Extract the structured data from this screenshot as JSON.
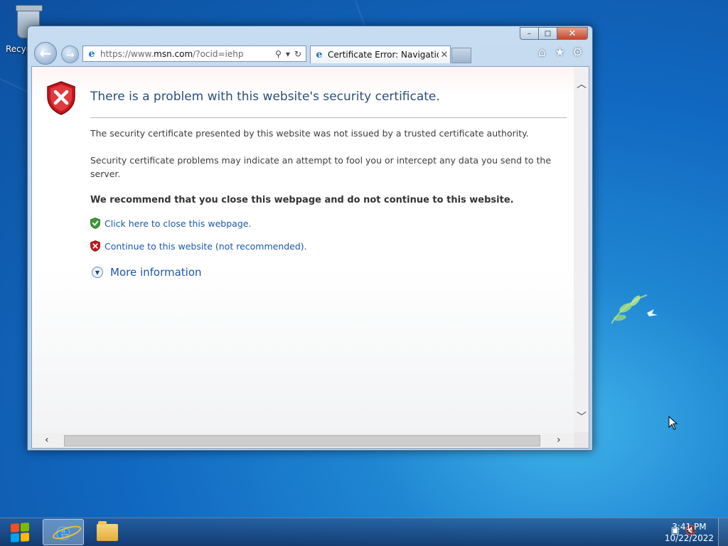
{
  "desktop": {
    "recycle_bin_label": "Recyc"
  },
  "browser": {
    "address": {
      "url_prefix": "https://www.",
      "url_host": "msn.com",
      "url_suffix": "/?ocid=iehp",
      "search_icon": "⚲",
      "dropdown_icon": "▾",
      "refresh_icon": "↻"
    },
    "tab": {
      "title": "Certificate Error: Navigation...",
      "close_glyph": "✕"
    },
    "window_controls": {
      "minimize": "–",
      "maximize": "□",
      "close": "✕"
    },
    "nav": {
      "back_glyph": "←",
      "forward_glyph": "→"
    },
    "toolbar": {
      "home_glyph": "⌂",
      "favorites_glyph": "★",
      "tools_glyph": "⚙"
    }
  },
  "page": {
    "title": "There is a problem with this website's security certificate.",
    "para1": "The security certificate presented by this website was not issued by a trusted certificate authority.",
    "para2": "Security certificate problems may indicate an attempt to fool you or intercept any data you send to the server.",
    "recommendation": "We recommend that you close this webpage and do not continue to this website.",
    "close_link": "Click here to close this webpage.",
    "continue_link": "Continue to this website (not recommended).",
    "more_info": "More information"
  },
  "scrollbars": {
    "up_glyph": "︿",
    "down_glyph": "﹀",
    "left_glyph": "‹",
    "right_glyph": "›"
  },
  "taskbar": {
    "clock_time": "3:41 PM",
    "clock_date": "10/22/2022",
    "network_icon": "▣",
    "volume_icon": "🔇"
  },
  "colors": {
    "title_blue": "#2d4e7a",
    "link_blue": "#1e57a8",
    "shield_red": "#c4161c",
    "shield_green": "#3e9b3a"
  }
}
